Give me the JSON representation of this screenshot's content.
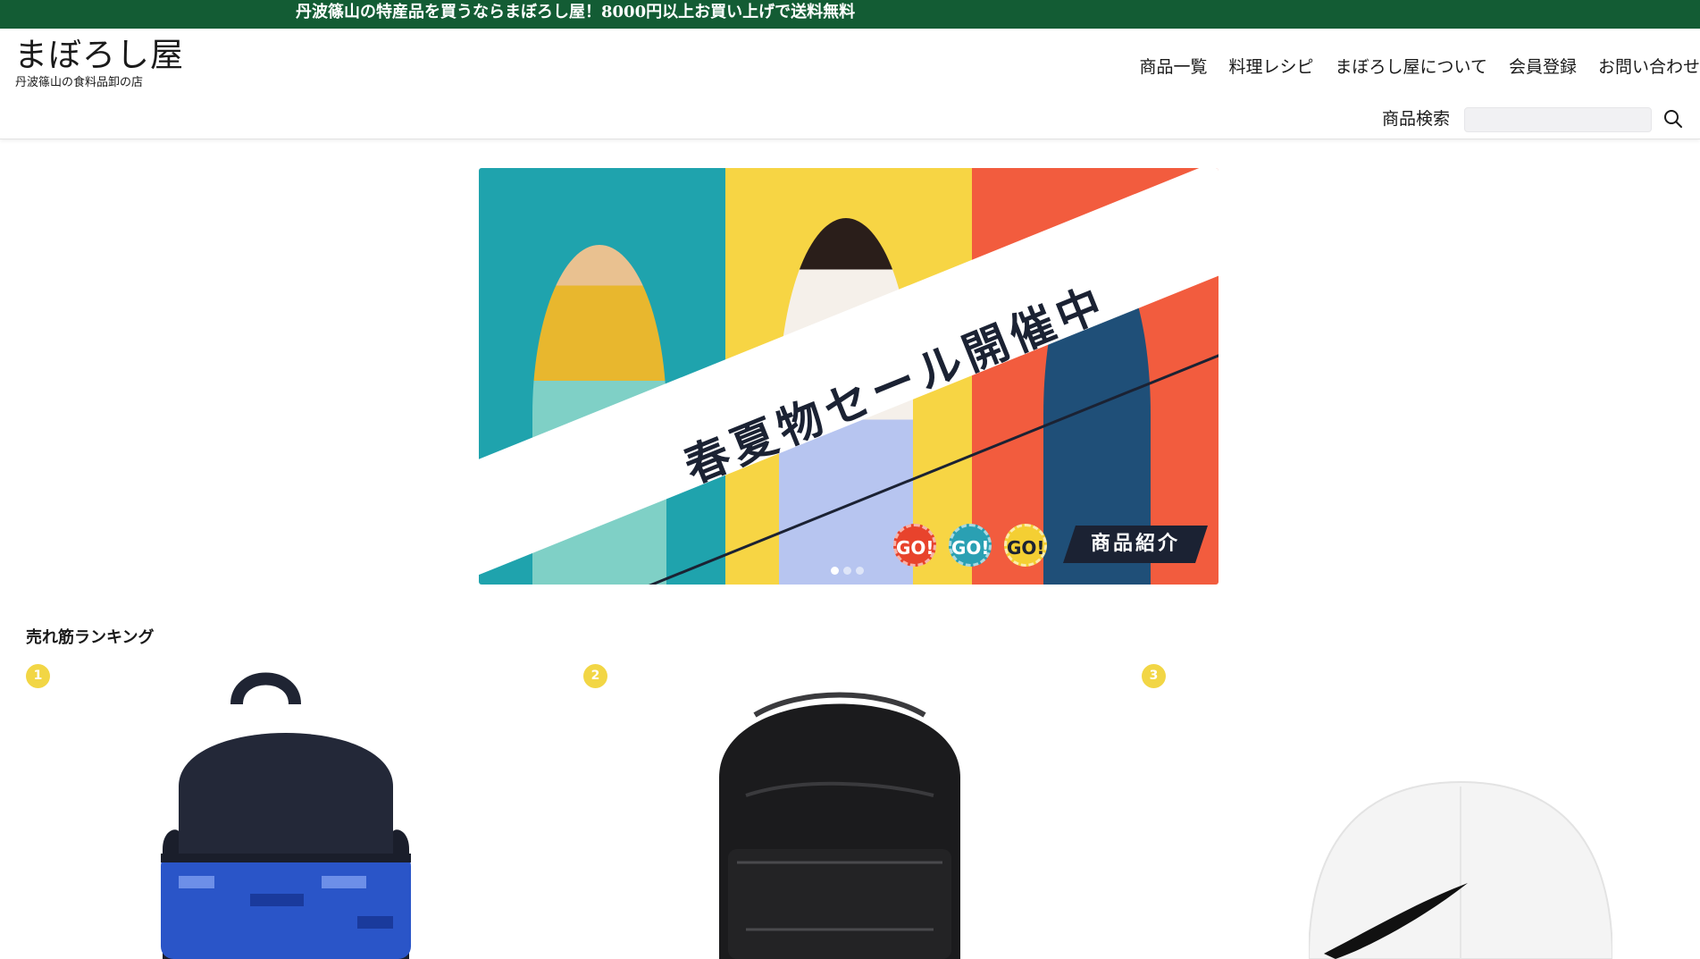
{
  "announcement": "丹波篠山の特産品を買うならまぼろし屋！8000円以上お買い上げで送料無料",
  "logo": {
    "title": "まぼろし屋",
    "subtitle": "丹波篠山の食料品卸の店"
  },
  "nav": {
    "items": [
      {
        "label": "商品一覧"
      },
      {
        "label": "料理レシピ"
      },
      {
        "label": "まぼろし屋について"
      },
      {
        "label": "会員登録"
      },
      {
        "label": "お問い合わせ"
      }
    ]
  },
  "search": {
    "label": "商品検索",
    "value": "",
    "placeholder": ""
  },
  "banner": {
    "headline": "春夏物セール開催中",
    "go_labels": [
      "GO!",
      "GO!",
      "GO!"
    ],
    "cta": "商品紹介",
    "slide_count": 3,
    "active_slide": 1,
    "colors": {
      "teal": "#1fa3ad",
      "yellow": "#f7d544",
      "red": "#f25c3e",
      "navy": "#1b2233"
    }
  },
  "ranking": {
    "title": "売れ筋ランキング",
    "items": [
      {
        "rank": "1",
        "product_icon": "backpack-icon"
      },
      {
        "rank": "2",
        "product_icon": "backpack-icon"
      },
      {
        "rank": "3",
        "product_icon": "cap-icon"
      }
    ]
  },
  "colors": {
    "announcement_bg": "#135c34",
    "badge": "#f2d645"
  }
}
